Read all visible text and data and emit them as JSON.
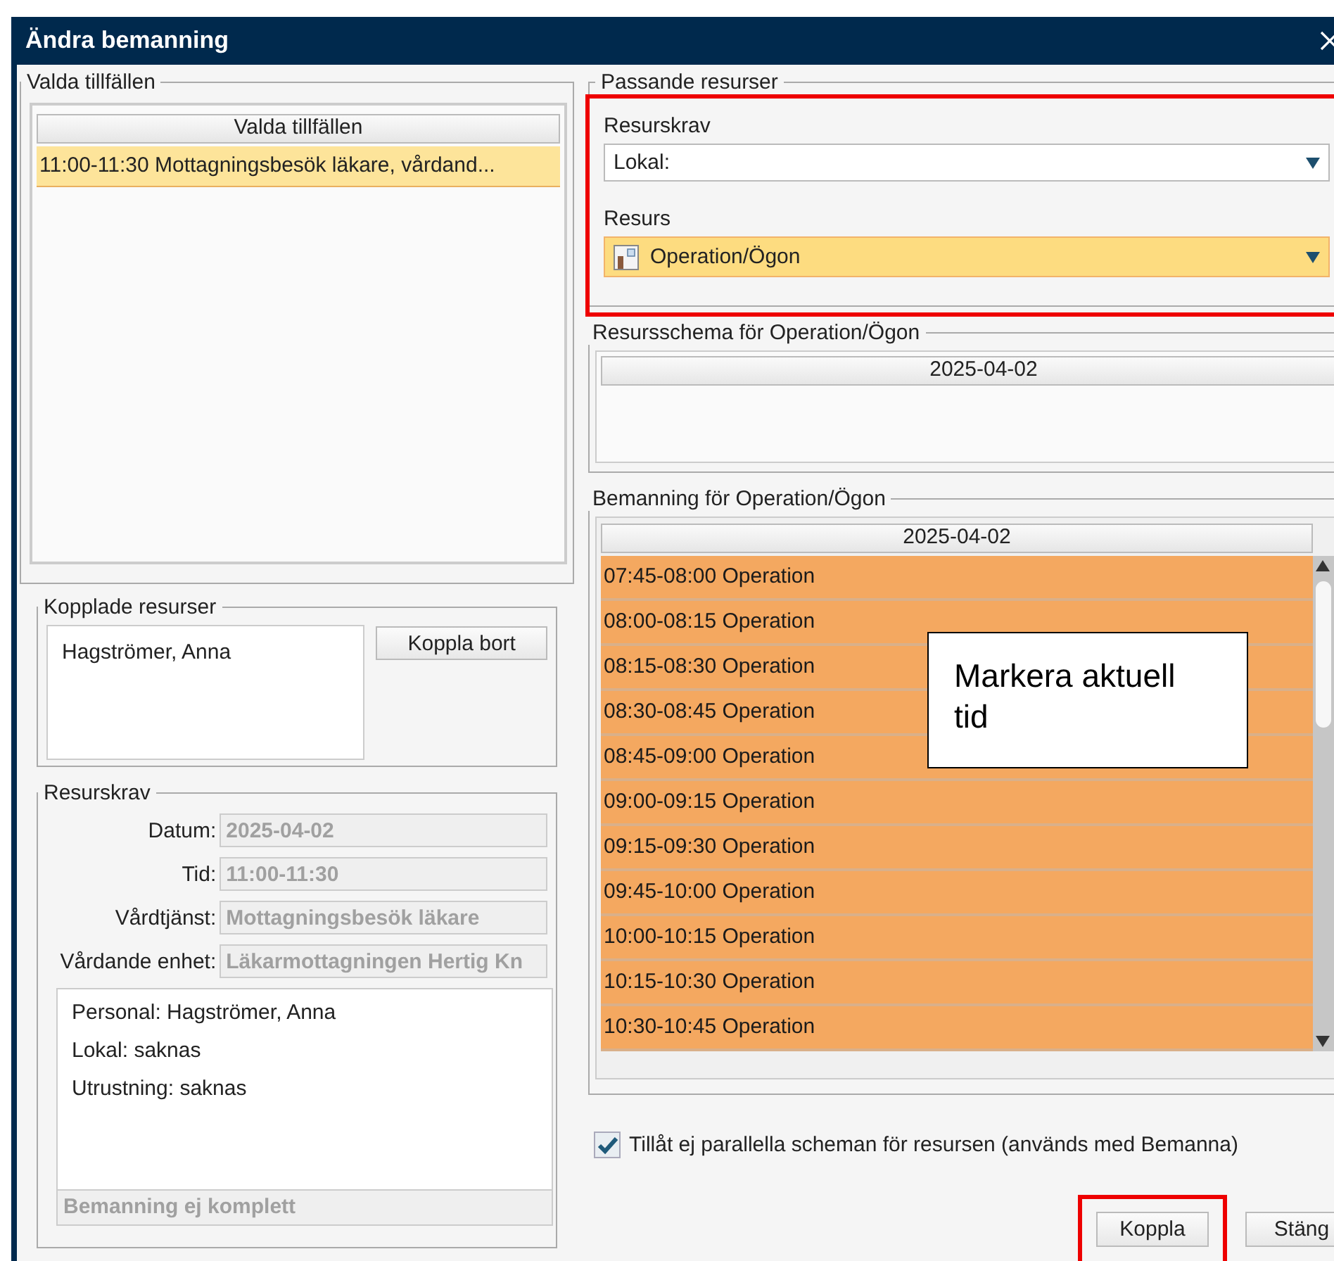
{
  "window": {
    "title": "Ändra bemanning"
  },
  "selected_occasions": {
    "title": "Valda tillfällen",
    "column": "Valda tillfällen",
    "rows": [
      {
        "text": "11:00-11:30 Mottagningsbesök läkare, vårdand...",
        "selected": true
      }
    ]
  },
  "linked_resources": {
    "title": "Kopplade resurser",
    "items": [
      "Hagströmer, Anna"
    ],
    "button": "Koppla bort"
  },
  "requirements": {
    "title": "Resurskrav",
    "fields": [
      {
        "label": "Datum:",
        "value": "2025-04-02"
      },
      {
        "label": "Tid:",
        "value": "11:00-11:30"
      },
      {
        "label": "Vårdtjänst:",
        "value": "Mottagningsbesök läkare"
      },
      {
        "label": "Vårdande enhet:",
        "value": "Läkarmottagningen Hertig Kn"
      }
    ],
    "summary": [
      "Personal: Hagströmer, Anna",
      "Lokal: saknas",
      "Utrustning: saknas"
    ],
    "status": "Bemanning ej komplett"
  },
  "matching_resources": {
    "title": "Passande resurser",
    "requirement_label": "Resurskrav",
    "requirement_value": "Lokal:",
    "resource_label": "Resurs",
    "resource_value": "Operation/Ögon"
  },
  "resource_schedule": {
    "title": "Resursschema för Operation/Ögon",
    "column": "2025-04-02"
  },
  "staffing": {
    "title": "Bemanning för Operation/Ögon",
    "column": "2025-04-02",
    "rows": [
      "07:45-08:00 Operation",
      "08:00-08:15 Operation",
      "08:15-08:30 Operation",
      "08:30-08:45 Operation",
      "08:45-09:00 Operation",
      "09:00-09:15 Operation",
      "09:15-09:30 Operation",
      "09:45-10:00 Operation",
      "10:00-10:15 Operation",
      "10:15-10:30 Operation",
      "10:30-10:45 Operation"
    ]
  },
  "callout": {
    "text": "Markera aktuell tid"
  },
  "parallel_checkbox": {
    "label": "Tillåt ej parallella scheman för resursen (används med Bemanna)",
    "checked": true
  },
  "buttons": [
    {
      "label": "Koppla",
      "highlighted": true
    },
    {
      "label": "Stäng",
      "highlighted": false
    }
  ]
}
